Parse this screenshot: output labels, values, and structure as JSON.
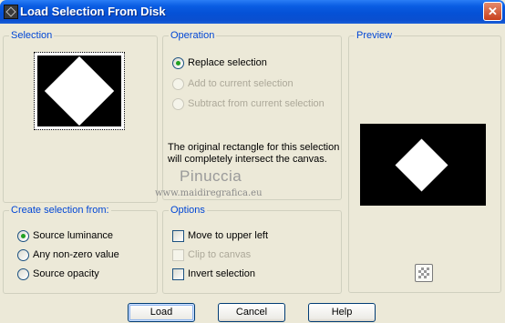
{
  "window": {
    "title": "Load Selection From Disk",
    "close_glyph": "✕"
  },
  "selection": {
    "legend": "Selection"
  },
  "operation": {
    "legend": "Operation",
    "options": [
      {
        "label": "Replace selection",
        "checked": true,
        "enabled": true
      },
      {
        "label": "Add to current selection",
        "checked": false,
        "enabled": false
      },
      {
        "label": "Subtract from current selection",
        "checked": false,
        "enabled": false
      }
    ],
    "info_text": "The original rectangle for this selection will completely intersect the canvas."
  },
  "preview": {
    "legend": "Preview"
  },
  "create_from": {
    "legend": "Create selection from:",
    "options": [
      {
        "label": "Source luminance",
        "checked": true
      },
      {
        "label": "Any non-zero value",
        "checked": false
      },
      {
        "label": "Source opacity",
        "checked": false
      }
    ]
  },
  "options": {
    "legend": "Options",
    "items": [
      {
        "label": "Move to upper left",
        "checked": false,
        "enabled": true
      },
      {
        "label": "Clip to canvas",
        "checked": false,
        "enabled": false
      },
      {
        "label": "Invert selection",
        "checked": false,
        "enabled": true
      }
    ]
  },
  "watermark": {
    "name": "Pinuccia",
    "site": "www.maidiregrafica.eu"
  },
  "buttons": {
    "load": "Load",
    "cancel": "Cancel",
    "help": "Help"
  },
  "icons": {
    "app": "selection-app-icon",
    "close": "close-icon",
    "transparency": "checkerboard-icon"
  }
}
